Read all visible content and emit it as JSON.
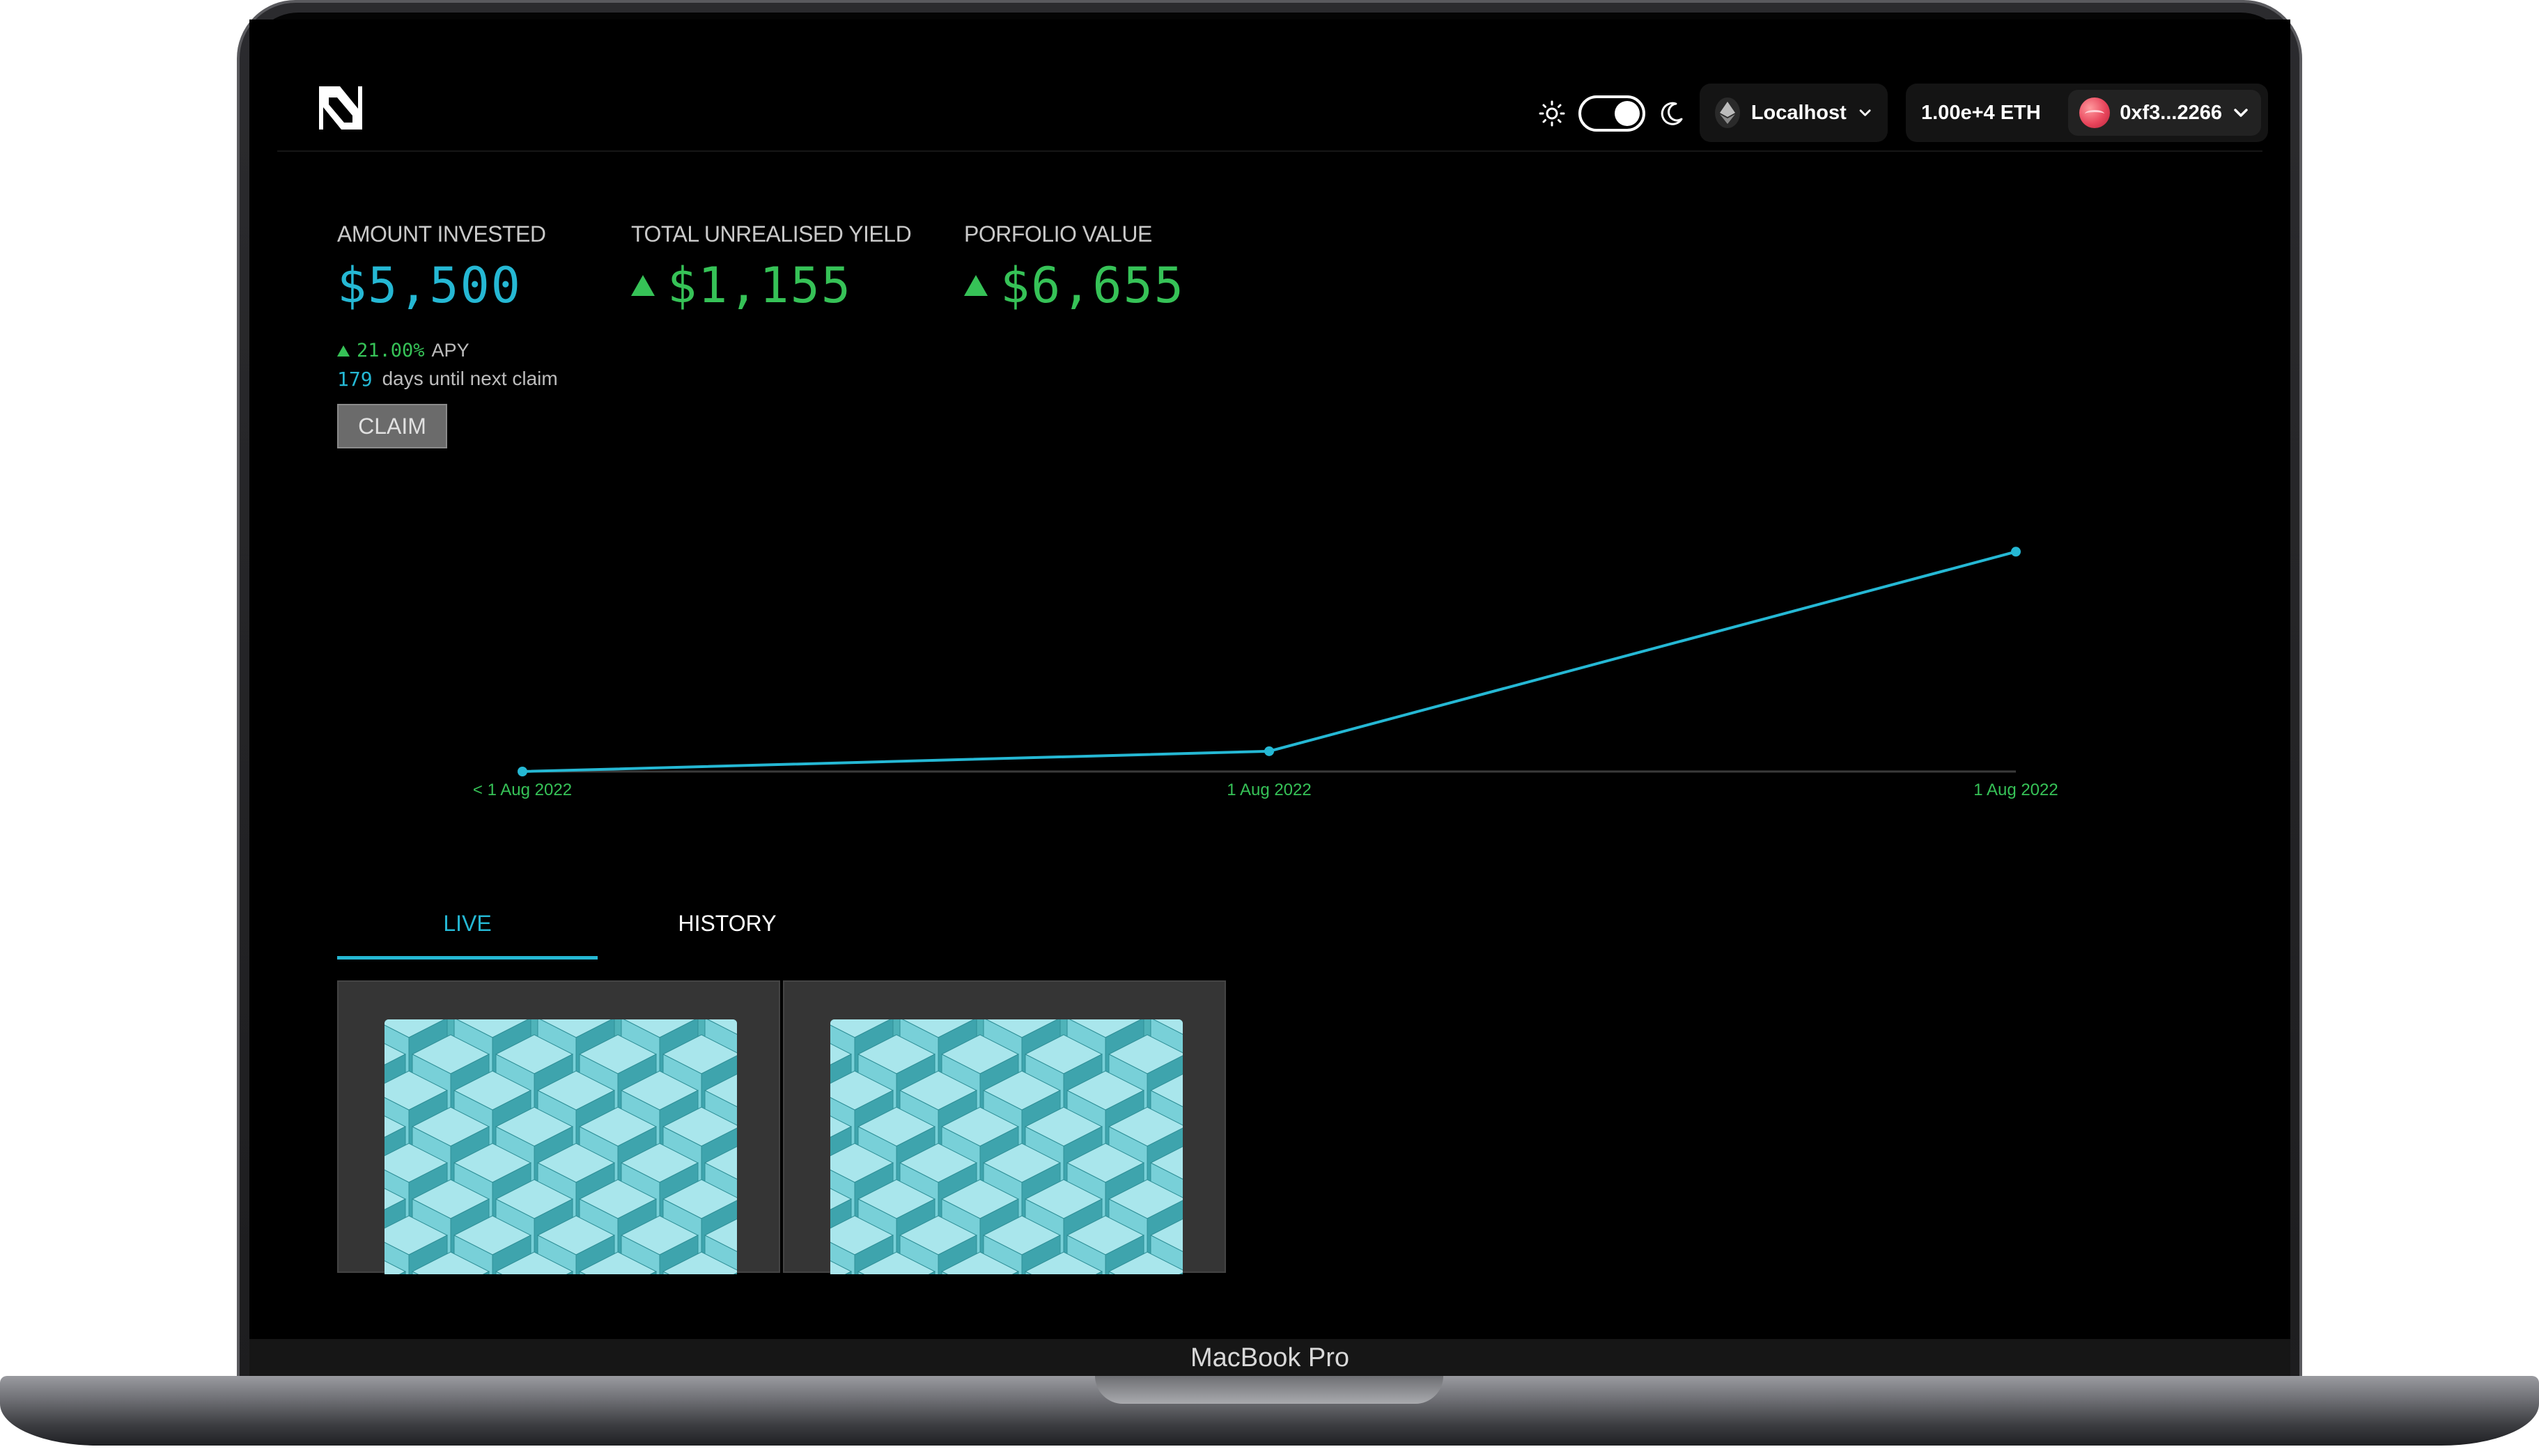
{
  "device": {
    "label": "MacBook Pro"
  },
  "header": {
    "network": {
      "label": "Localhost",
      "icon": "ethereum-icon"
    },
    "account": {
      "balance": "1.00e+4 ETH",
      "address": "0xf3...2266"
    },
    "theme": {
      "mode": "dark"
    }
  },
  "stats": {
    "amount_invested": {
      "label": "AMOUNT INVESTED",
      "value": "$5,500"
    },
    "unrealised_yield": {
      "label": "TOTAL UNREALISED YIELD",
      "value": "$1,155"
    },
    "portfolio_value": {
      "label": "PORFOLIO VALUE",
      "value": "$6,655"
    },
    "apy": {
      "value": "21.00%",
      "label": "APY"
    },
    "next_claim": {
      "days": "179",
      "label": "days until next claim"
    },
    "claim_button": "CLAIM"
  },
  "chart_data": {
    "type": "line",
    "title": "",
    "xlabel": "",
    "ylabel": "",
    "x": [
      "< 1 Aug 2022",
      "1 Aug 2022",
      "1 Aug 2022"
    ],
    "series": [
      {
        "values": [
          0,
          6,
          65
        ]
      }
    ],
    "ylim": [
      0,
      70
    ],
    "grid": false,
    "color": "#25b8d4",
    "tick_color": "#36c257"
  },
  "tabs": [
    {
      "label": "LIVE",
      "active": true
    },
    {
      "label": "HISTORY",
      "active": false
    }
  ],
  "cards": [
    {
      "image": "teal-cubes-artwork"
    },
    {
      "image": "teal-cubes-artwork"
    }
  ],
  "colors": {
    "accent": "#25b8d4",
    "positive": "#36c257",
    "background": "#000000"
  }
}
